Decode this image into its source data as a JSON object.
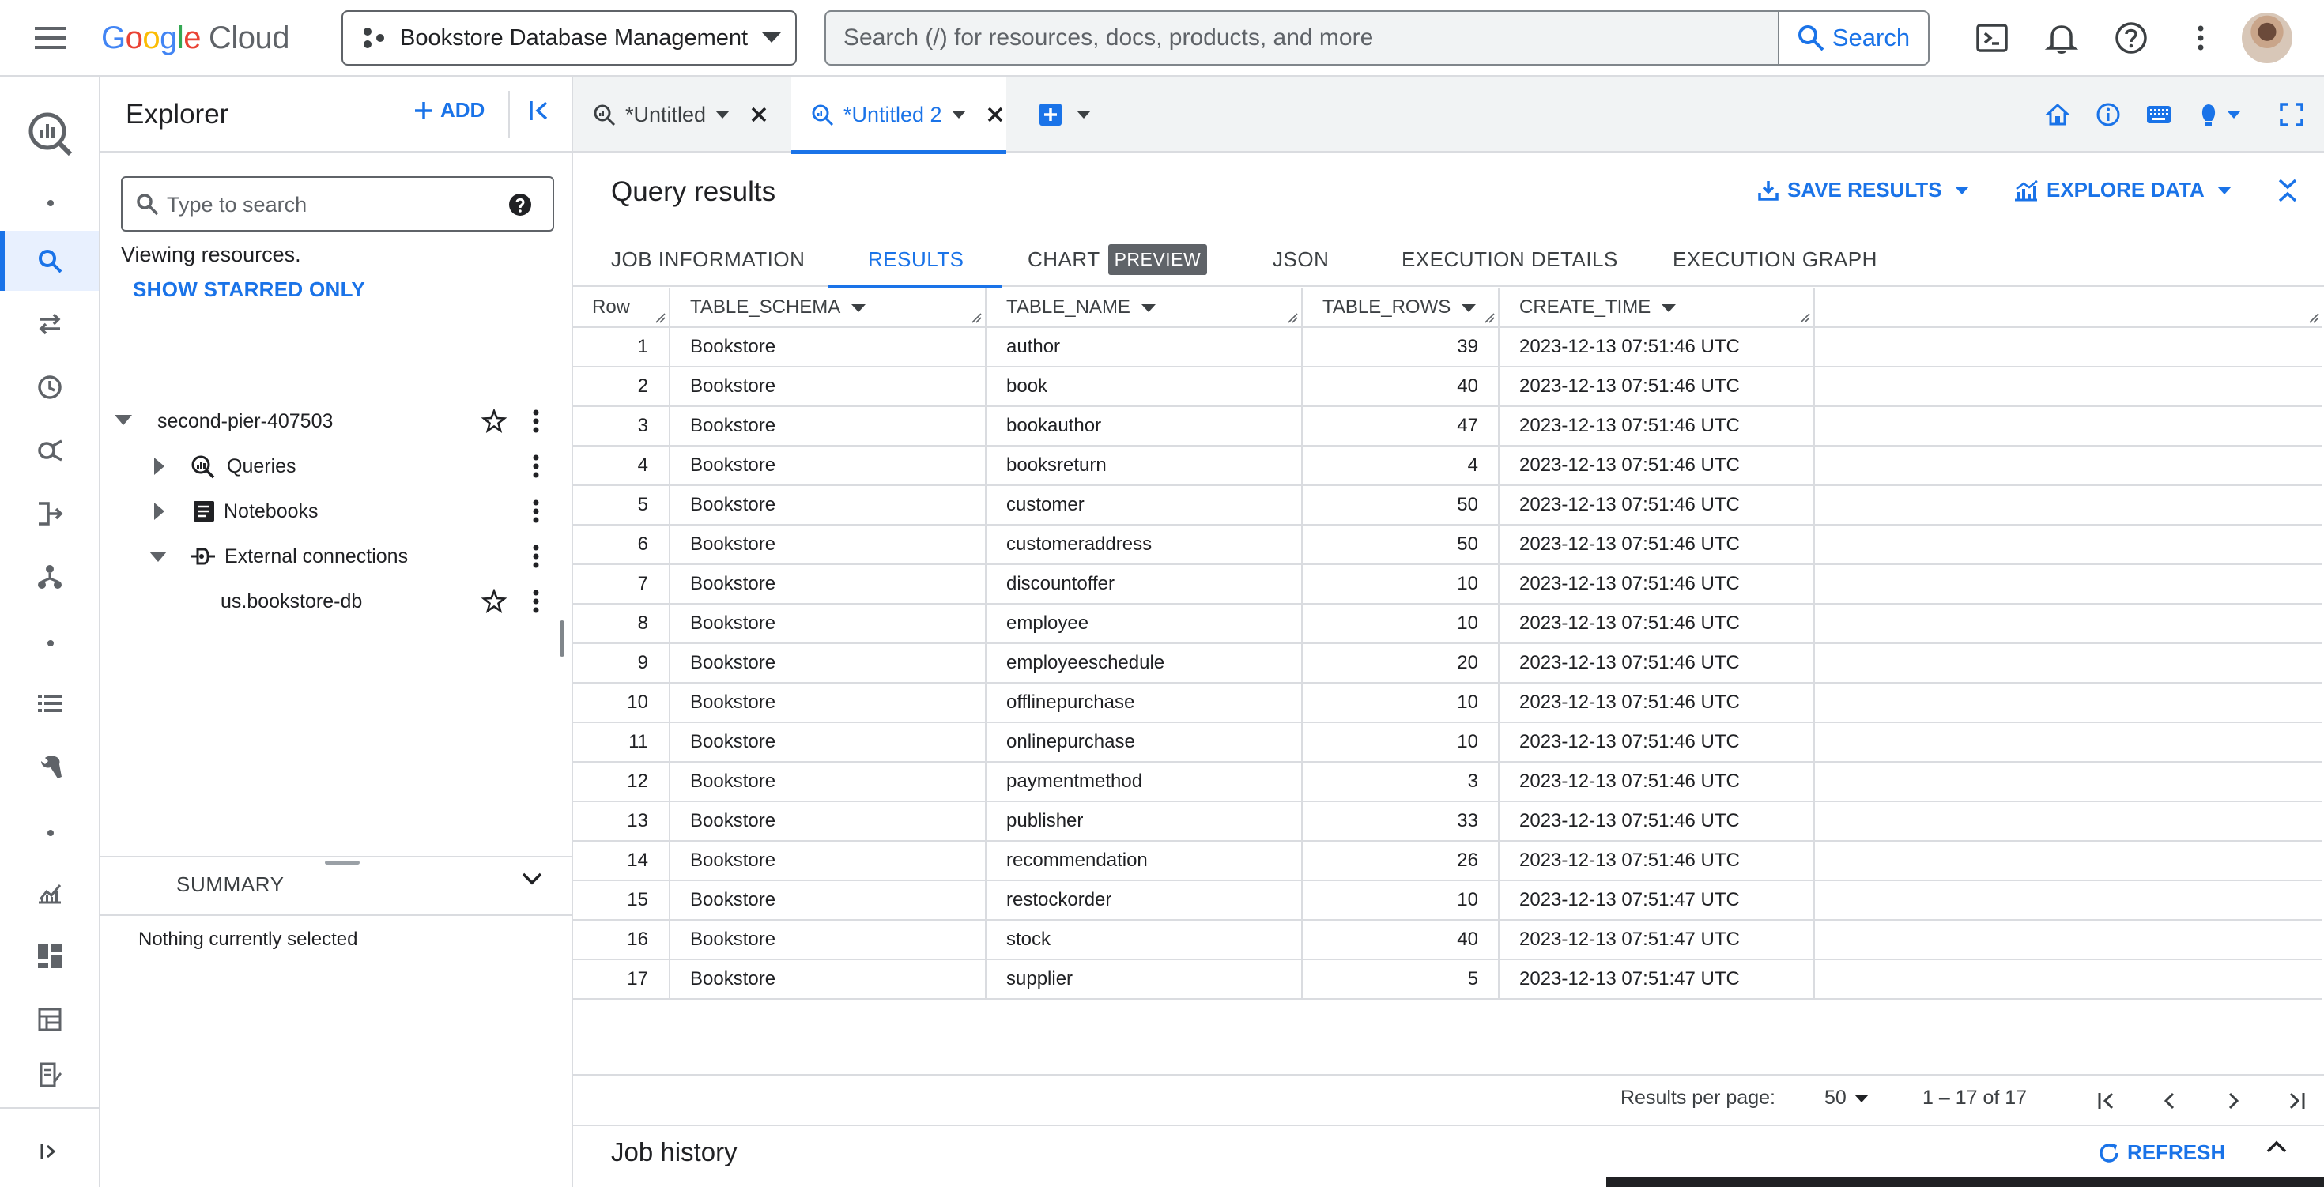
{
  "topbar": {
    "logo": {
      "g1": "G",
      "o1": "o",
      "o2": "o",
      "g2": "g",
      "l": "l",
      "e": "e",
      "cloud": "Cloud"
    },
    "project_name": "Bookstore Database Management",
    "search_placeholder": "Search (/) for resources, docs, products, and more",
    "search_button": "Search"
  },
  "explorer": {
    "title": "Explorer",
    "add_label": "ADD",
    "search_placeholder": "Type to search",
    "viewing_text": "Viewing resources.",
    "show_starred": "SHOW STARRED ONLY",
    "project": "second-pier-407503",
    "nodes": {
      "queries": "Queries",
      "notebooks": "Notebooks",
      "external": "External connections",
      "connection": "us.bookstore-db"
    },
    "summary_label": "SUMMARY",
    "nothing_selected": "Nothing currently selected"
  },
  "tabs": [
    {
      "label": "*Untitled"
    },
    {
      "label": "*Untitled 2"
    }
  ],
  "results_panel": {
    "title": "Query results",
    "save_results": "SAVE RESULTS",
    "explore_data": "EXPLORE DATA",
    "tabs": {
      "job_info": "JOB INFORMATION",
      "results": "RESULTS",
      "chart": "CHART",
      "preview": "PREVIEW",
      "json": "JSON",
      "exec_details": "EXECUTION DETAILS",
      "exec_graph": "EXECUTION GRAPH"
    },
    "columns": {
      "row": "Row",
      "schema": "TABLE_SCHEMA",
      "name": "TABLE_NAME",
      "rows": "TABLE_ROWS",
      "time": "CREATE_TIME"
    },
    "rows": [
      {
        "n": "1",
        "schema": "Bookstore",
        "name": "author",
        "rows": "39",
        "time": "2023-12-13 07:51:46 UTC"
      },
      {
        "n": "2",
        "schema": "Bookstore",
        "name": "book",
        "rows": "40",
        "time": "2023-12-13 07:51:46 UTC"
      },
      {
        "n": "3",
        "schema": "Bookstore",
        "name": "bookauthor",
        "rows": "47",
        "time": "2023-12-13 07:51:46 UTC"
      },
      {
        "n": "4",
        "schema": "Bookstore",
        "name": "booksreturn",
        "rows": "4",
        "time": "2023-12-13 07:51:46 UTC"
      },
      {
        "n": "5",
        "schema": "Bookstore",
        "name": "customer",
        "rows": "50",
        "time": "2023-12-13 07:51:46 UTC"
      },
      {
        "n": "6",
        "schema": "Bookstore",
        "name": "customeraddress",
        "rows": "50",
        "time": "2023-12-13 07:51:46 UTC"
      },
      {
        "n": "7",
        "schema": "Bookstore",
        "name": "discountoffer",
        "rows": "10",
        "time": "2023-12-13 07:51:46 UTC"
      },
      {
        "n": "8",
        "schema": "Bookstore",
        "name": "employee",
        "rows": "10",
        "time": "2023-12-13 07:51:46 UTC"
      },
      {
        "n": "9",
        "schema": "Bookstore",
        "name": "employeeschedule",
        "rows": "20",
        "time": "2023-12-13 07:51:46 UTC"
      },
      {
        "n": "10",
        "schema": "Bookstore",
        "name": "offlinepurchase",
        "rows": "10",
        "time": "2023-12-13 07:51:46 UTC"
      },
      {
        "n": "11",
        "schema": "Bookstore",
        "name": "onlinepurchase",
        "rows": "10",
        "time": "2023-12-13 07:51:46 UTC"
      },
      {
        "n": "12",
        "schema": "Bookstore",
        "name": "paymentmethod",
        "rows": "3",
        "time": "2023-12-13 07:51:46 UTC"
      },
      {
        "n": "13",
        "schema": "Bookstore",
        "name": "publisher",
        "rows": "33",
        "time": "2023-12-13 07:51:46 UTC"
      },
      {
        "n": "14",
        "schema": "Bookstore",
        "name": "recommendation",
        "rows": "26",
        "time": "2023-12-13 07:51:46 UTC"
      },
      {
        "n": "15",
        "schema": "Bookstore",
        "name": "restockorder",
        "rows": "10",
        "time": "2023-12-13 07:51:47 UTC"
      },
      {
        "n": "16",
        "schema": "Bookstore",
        "name": "stock",
        "rows": "40",
        "time": "2023-12-13 07:51:47 UTC"
      },
      {
        "n": "17",
        "schema": "Bookstore",
        "name": "supplier",
        "rows": "5",
        "time": "2023-12-13 07:51:47 UTC"
      }
    ],
    "pager": {
      "per_page_label": "Results per page:",
      "per_page": "50",
      "range": "1 – 17 of 17"
    }
  },
  "job_history": {
    "title": "Job history",
    "refresh": "REFRESH"
  },
  "colors": {
    "accent": "#1a73e8",
    "border": "#dadce0",
    "text": "#202124",
    "muted": "#5f6368"
  }
}
